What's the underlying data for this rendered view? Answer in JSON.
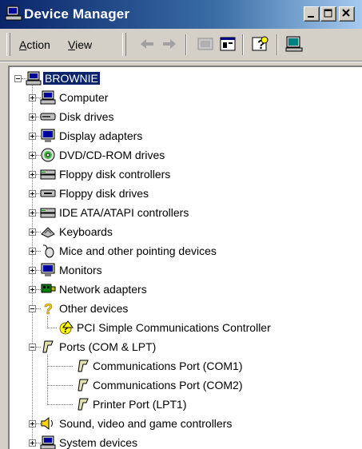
{
  "window": {
    "title": "Device Manager"
  },
  "menus": [
    {
      "label": "Action",
      "mnemonic": "A"
    },
    {
      "label": "View",
      "mnemonic": "V"
    }
  ],
  "toolbar": {
    "icons": [
      "back-arrow-icon",
      "forward-arrow-icon",
      "up-folder-icon",
      "properties-icon",
      "help-icon",
      "scan-hardware-icon"
    ]
  },
  "tree": {
    "root": {
      "label": "BROWNIE"
    },
    "categories": [
      {
        "label": "Computer",
        "icon": "computer-icon"
      },
      {
        "label": "Disk drives",
        "icon": "disk-drive-icon"
      },
      {
        "label": "Display adapters",
        "icon": "display-adapter-icon"
      },
      {
        "label": "DVD/CD-ROM drives",
        "icon": "cdrom-icon"
      },
      {
        "label": "Floppy disk controllers",
        "icon": "controller-icon"
      },
      {
        "label": "Floppy disk drives",
        "icon": "floppy-icon"
      },
      {
        "label": "IDE ATA/ATAPI controllers",
        "icon": "controller-icon"
      },
      {
        "label": "Keyboards",
        "icon": "keyboard-icon"
      },
      {
        "label": "Mice and other pointing devices",
        "icon": "mouse-icon"
      },
      {
        "label": "Monitors",
        "icon": "monitor-icon"
      },
      {
        "label": "Network adapters",
        "icon": "network-adapter-icon"
      },
      {
        "label": "Other devices",
        "icon": "unknown-device-icon",
        "children": [
          "PCI Simple Communications Controller"
        ]
      },
      {
        "label": "Ports (COM & LPT)",
        "icon": "port-icon",
        "children": [
          "Communications Port (COM1)",
          "Communications Port (COM2)",
          "Printer Port (LPT1)"
        ]
      },
      {
        "label": "Sound, video and game controllers",
        "icon": "sound-icon"
      },
      {
        "label": "System devices",
        "icon": "computer-icon"
      }
    ]
  }
}
